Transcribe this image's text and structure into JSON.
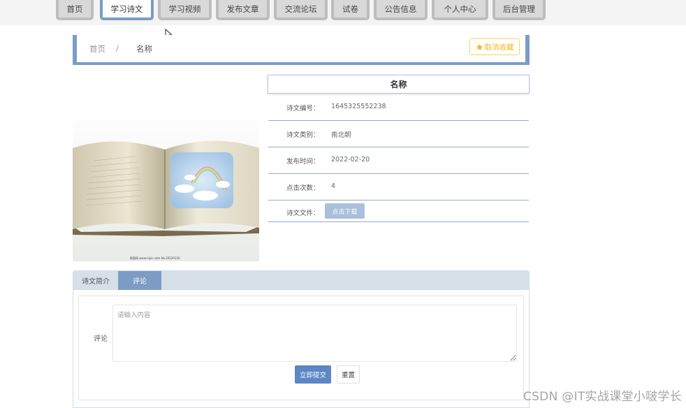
{
  "nav": {
    "items": [
      {
        "label": "首页"
      },
      {
        "label": "学习诗文"
      },
      {
        "label": "学习视频"
      },
      {
        "label": "发布文章"
      },
      {
        "label": "交流论坛"
      },
      {
        "label": "试卷"
      },
      {
        "label": "公告信息"
      },
      {
        "label": "个人中心"
      },
      {
        "label": "后台管理"
      }
    ],
    "active": "学习诗文"
  },
  "breadcrumb": {
    "home": "首页",
    "separator": "/",
    "current": "名称"
  },
  "favorite": {
    "icon": "star-icon",
    "label": "取消收藏"
  },
  "detail": {
    "title": "名称",
    "code": {
      "label": "诗文编号：",
      "value": "1645325552238"
    },
    "category": {
      "label": "诗文类别：",
      "value": "南北朝"
    },
    "publish_time": {
      "label": "发布时间：",
      "value": "2022-02-20"
    },
    "clicks": {
      "label": "点击次数：",
      "value": "4"
    },
    "file": {
      "label": "诗文文件：",
      "button": "点击下载"
    }
  },
  "cover_caption": "昵图网 www.nipic.com  No.20120116",
  "tabs": [
    {
      "label": "诗文简介"
    },
    {
      "label": "评论"
    }
  ],
  "comment": {
    "label": "评论",
    "placeholder": "请输入内容",
    "submit": "立即提交",
    "reset": "重置"
  },
  "watermark": "CSDN @IT实战课堂小啵学长",
  "colors": {
    "accent": "#7c9cc6",
    "primary_button": "#5c86c4",
    "favorite": "#f3b61f"
  }
}
